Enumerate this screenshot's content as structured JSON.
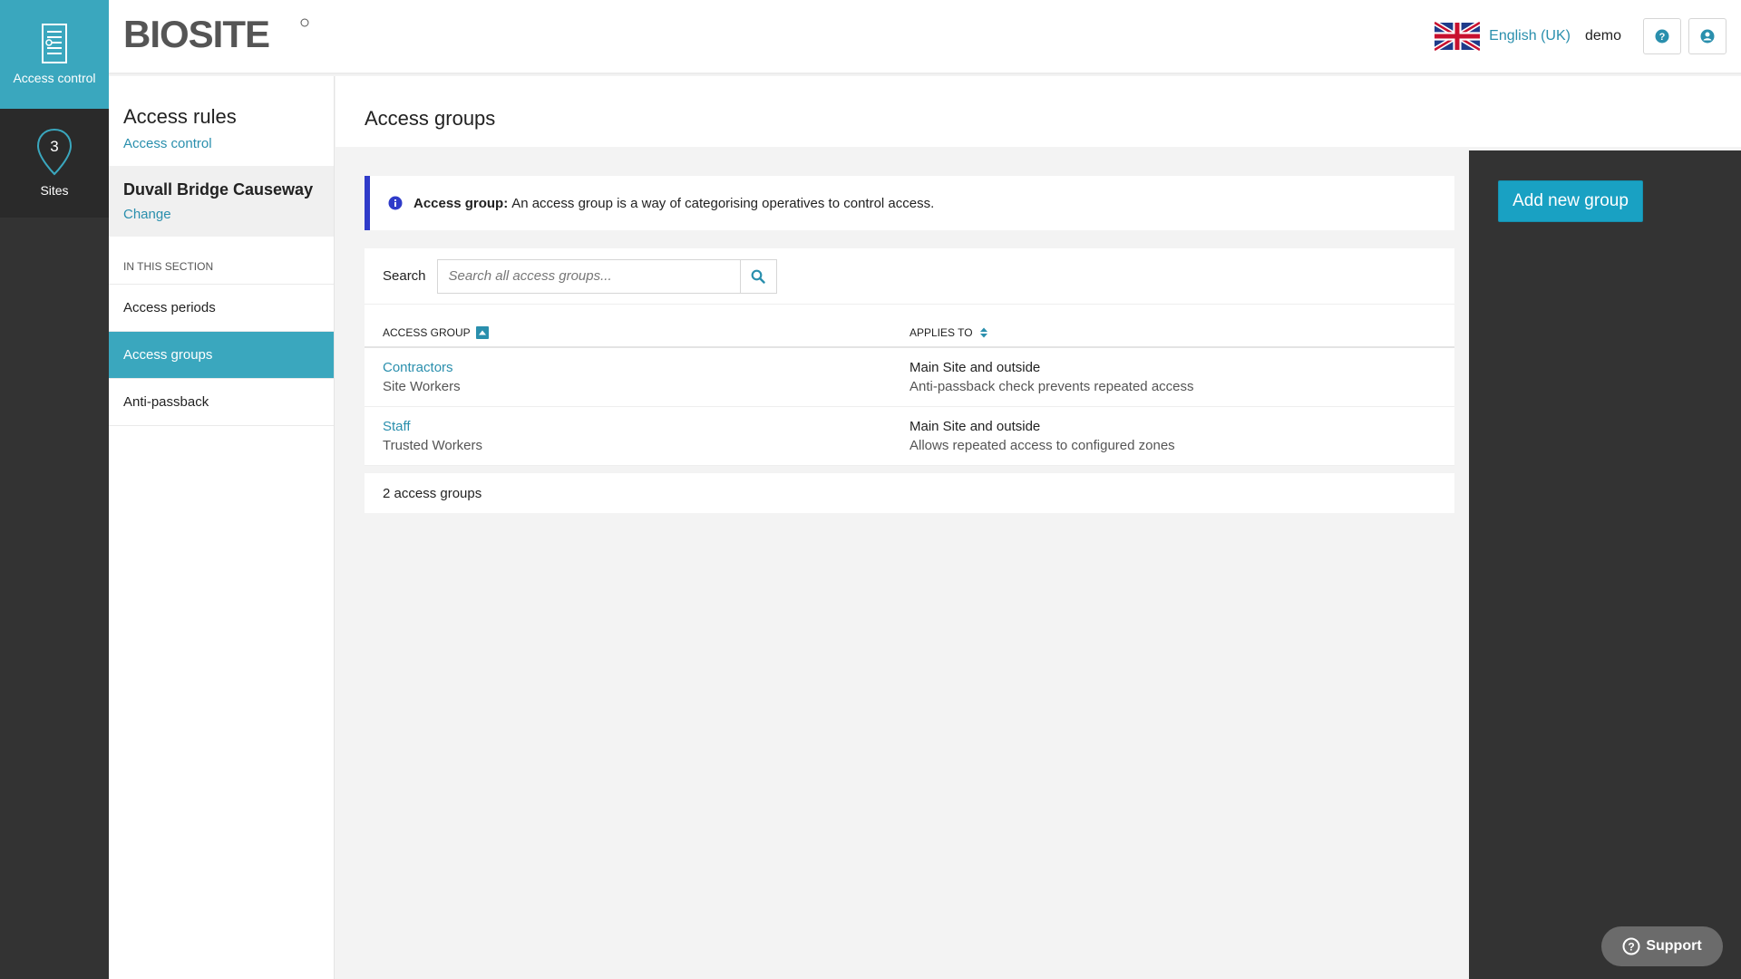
{
  "rail": {
    "access_control_label": "Access control",
    "sites_label": "Sites",
    "sites_count": "3"
  },
  "brand": {
    "logo_text": "BIOSITE"
  },
  "topbar": {
    "language": "English (UK)",
    "user": "demo",
    "icons": {
      "flag": "uk-flag-icon",
      "help": "help-icon",
      "account": "user-icon"
    }
  },
  "subnav": {
    "title": "Access rules",
    "parent_link": "Access control",
    "site_name": "Duvall Bridge Causeway",
    "site_change": "Change",
    "section_label": "IN THIS SECTION",
    "items": [
      {
        "label": "Access periods",
        "active": false
      },
      {
        "label": "Access groups",
        "active": true
      },
      {
        "label": "Anti-passback",
        "active": false
      }
    ]
  },
  "main": {
    "title": "Access groups",
    "add_button": "Add new group",
    "info": {
      "label": "Access group:",
      "text": "An access group is a way of categorising operatives to control access."
    },
    "search": {
      "label": "Search",
      "placeholder": "Search all access groups...",
      "value": ""
    },
    "table": {
      "headers": [
        "ACCESS GROUP",
        "APPLIES TO"
      ],
      "rows": [
        {
          "name": "Contractors",
          "type": "Site Workers",
          "applies_to": "Main Site and outside",
          "detail": "Anti-passback check prevents repeated access"
        },
        {
          "name": "Staff",
          "type": "Trusted Workers",
          "applies_to": "Main Site and outside",
          "detail": "Allows repeated access to configured zones"
        }
      ]
    },
    "count_text": "2 access groups"
  },
  "support": {
    "label": "Support"
  },
  "colors": {
    "accent": "#3aa7be",
    "button": "#19a1c3",
    "link": "#2a8fad",
    "info_border": "#2f3bc9",
    "rail_bg": "#333333"
  }
}
